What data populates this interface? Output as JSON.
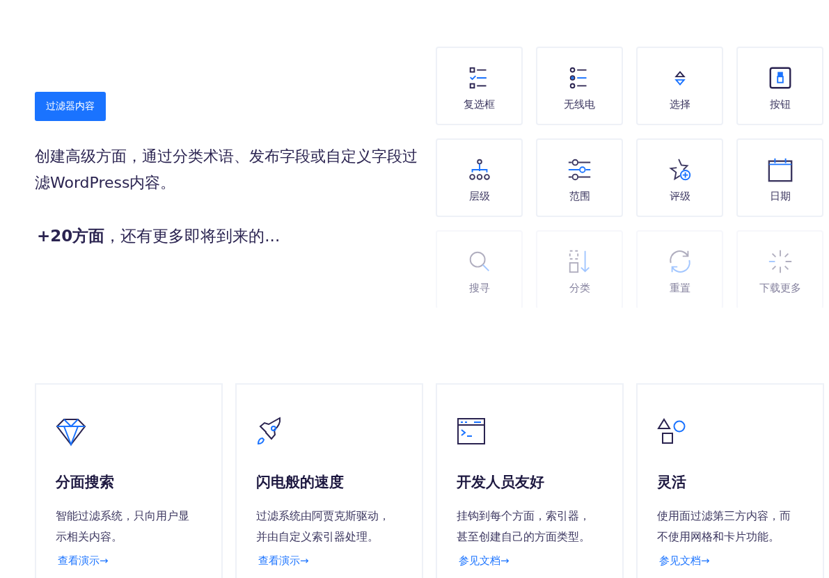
{
  "hero": {
    "badge": "过滤器内容",
    "lead": "创建高级方面，通过分类术语、发布字段或自定义字段过滤WordPress内容。",
    "more": "**+20方面**，还有更多即将到来的..."
  },
  "facets": [
    {
      "kind": "checkbox",
      "label": "复选框",
      "faded": false
    },
    {
      "kind": "radio",
      "label": "无线电",
      "faded": false
    },
    {
      "kind": "select",
      "label": "选择",
      "faded": false
    },
    {
      "kind": "button",
      "label": "按钮",
      "faded": false
    },
    {
      "kind": "hierarchy",
      "label": "层级",
      "faded": false
    },
    {
      "kind": "range",
      "label": "范围",
      "faded": false
    },
    {
      "kind": "rating",
      "label": "评级",
      "faded": false
    },
    {
      "kind": "date",
      "label": "日期",
      "faded": false
    },
    {
      "kind": "search",
      "label": "搜寻",
      "faded": true
    },
    {
      "kind": "sort",
      "label": "分类",
      "faded": true
    },
    {
      "kind": "reset",
      "label": "重置",
      "faded": true
    },
    {
      "kind": "loading",
      "label": "下载更多",
      "faded": true
    }
  ],
  "features": [
    {
      "kind": "diamond",
      "title": "分面搜索",
      "text": "智能过滤系统，只向用户显示相关内容。",
      "link": "查看演示→"
    },
    {
      "kind": "rocket",
      "title": "闪电般的速度",
      "text": "过滤系统由阿贾克斯驱动，并由自定义索引器处理。",
      "link": "查看演示→"
    },
    {
      "kind": "terminal",
      "title": "开发人员友好",
      "text": "挂钩到每个方面，索引器，甚至创建自己的方面类型。",
      "link": "参见文档→"
    },
    {
      "kind": "shapes",
      "title": "灵活",
      "text": "使用面过滤第三方内容，而不使用网格和卡片功能。",
      "link": "参见文档→"
    }
  ]
}
